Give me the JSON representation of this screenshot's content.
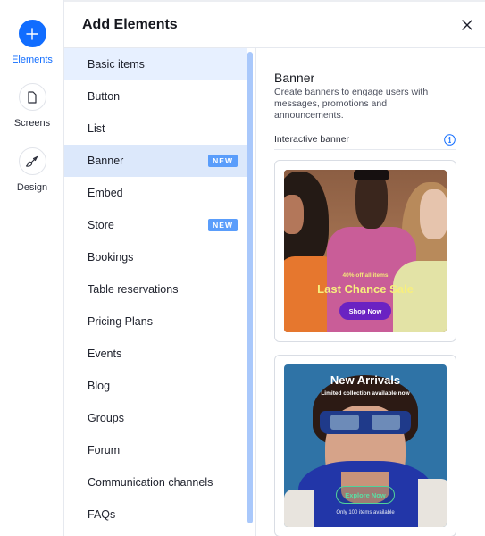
{
  "rail": {
    "items": [
      {
        "label": "Elements",
        "icon": "plus-icon",
        "active": true
      },
      {
        "label": "Screens",
        "icon": "page-icon",
        "active": false
      },
      {
        "label": "Design",
        "icon": "paintbrush-icon",
        "active": false
      }
    ]
  },
  "header": {
    "title": "Add Elements",
    "close_icon": "close-icon"
  },
  "categories": [
    {
      "label": "Basic items",
      "state": "selected"
    },
    {
      "label": "Button"
    },
    {
      "label": "List"
    },
    {
      "label": "Banner",
      "state": "hover",
      "badge": "NEW"
    },
    {
      "label": "Embed"
    },
    {
      "label": "Store",
      "badge": "NEW"
    },
    {
      "label": "Bookings"
    },
    {
      "label": "Table reservations"
    },
    {
      "label": "Pricing Plans"
    },
    {
      "label": "Events"
    },
    {
      "label": "Blog"
    },
    {
      "label": "Groups"
    },
    {
      "label": "Forum"
    },
    {
      "label": "Communication channels"
    },
    {
      "label": "FAQs"
    }
  ],
  "panel": {
    "title": "Banner",
    "description": "Create banners to engage users with messages, promotions and announcements.",
    "section_label": "Interactive banner",
    "info_icon": "info-icon",
    "banners": [
      {
        "subtitle": "40% off all items",
        "headline": "Last Chance Sale",
        "cta": "Shop Now"
      },
      {
        "headline": "New Arrivals",
        "subtitle": "Limited collection available now",
        "cta": "Explore Now",
        "note": "Only 100 items available"
      }
    ]
  },
  "colors": {
    "accent": "#116dff",
    "selected_bg": "#e7f0ff",
    "badge_bg": "#5a9dfb",
    "scrollbar": "#a9c8fb"
  }
}
